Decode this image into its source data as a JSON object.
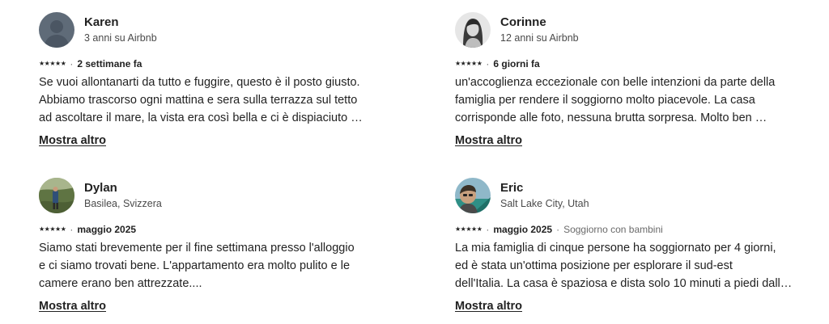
{
  "reviews": [
    {
      "name": "Karen",
      "subtitle": "3 anni su Airbnb",
      "stars": "★★★★★",
      "separator": "·",
      "when": "2 settimane fa",
      "stay": "",
      "lines": [
        "Se vuoi allontanarti da tutto e fuggire, questo è il posto giusto.",
        "Abbiamo trascorso ogni mattina e sera sulla terrazza sul tetto",
        "ad ascoltare il mare, la vista era così bella e ci è dispiaciuto …"
      ],
      "more": "Mostra altro",
      "avatar": "default-avatar"
    },
    {
      "name": "Corinne",
      "subtitle": "12 anni su Airbnb",
      "stars": "★★★★★",
      "separator": "·",
      "when": "6 giorni fa",
      "stay": "",
      "lines": [
        "un'accoglienza eccezionale con  belle intenzioni da parte della",
        "famiglia per rendere il soggiorno molto piacevole. La casa",
        "corrisponde alle foto, nessuna brutta sorpresa. Molto ben …"
      ],
      "more": "Mostra altro",
      "avatar": "photo-avatar-bw"
    },
    {
      "name": "Dylan",
      "subtitle": "Basilea, Svizzera",
      "stars": "★★★★★",
      "separator": "·",
      "when": "maggio 2025",
      "stay": "",
      "lines": [
        "Siamo stati brevemente per il fine settimana presso l'alloggio",
        "e ci siamo trovati bene. L'appartamento era molto pulito e le",
        "camere erano ben attrezzate...."
      ],
      "more": "Mostra altro",
      "avatar": "photo-avatar-outdoor"
    },
    {
      "name": "Eric",
      "subtitle": "Salt Lake City, Utah",
      "stars": "★★★★★",
      "separator": "·",
      "when": "maggio 2025",
      "stay": "Soggiorno con bambini",
      "lines": [
        "La mia famiglia di cinque persone ha soggiornato per 4 giorni,",
        "ed è stata un'ottima posizione per esplorare il sud-est",
        "dell'Italia. La casa è spaziosa e dista solo 10 minuti a piedi dall…"
      ],
      "more": "Mostra altro",
      "avatar": "photo-avatar-selfie"
    }
  ],
  "colors": {
    "text": "#222222",
    "muted": "#6a6a6a",
    "avatar_default": "#5f6b78"
  }
}
